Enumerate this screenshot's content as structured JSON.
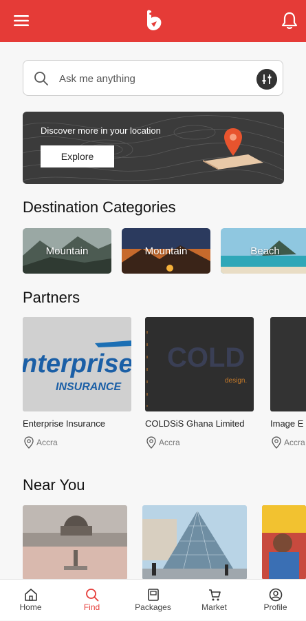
{
  "header": {
    "menu_icon": "hamburger-menu-icon",
    "logo_icon": "app-logo-icon",
    "bell_icon": "notification-bell-icon",
    "brand_color": "#e53b37"
  },
  "search": {
    "placeholder": "Ask me anything",
    "value": "",
    "search_icon": "search-icon",
    "filter_icon": "filter-sliders-icon"
  },
  "banner": {
    "title": "Discover more in your location",
    "button": "Explore",
    "pin_icon": "location-pin-map-icon"
  },
  "categories": {
    "title": "Destination Categories",
    "items": [
      {
        "label": "Mountain"
      },
      {
        "label": "Mountain"
      },
      {
        "label": "Beach"
      }
    ]
  },
  "partners": {
    "title": "Partners",
    "items": [
      {
        "name": "Enterprise Insurance",
        "location": "Accra",
        "logo_line1": "nterprise",
        "logo_line2": "INSURANCE"
      },
      {
        "name": "COLDSiS Ghana Limited",
        "location": "Accra",
        "logo_text": "COLD",
        "tagline": "design."
      },
      {
        "name": "Image E",
        "location": "Accra"
      }
    ]
  },
  "near_you": {
    "title": "Near You"
  },
  "tabs": [
    {
      "label": "Home",
      "icon": "home-icon"
    },
    {
      "label": "Find",
      "icon": "search-icon",
      "active": true
    },
    {
      "label": "Packages",
      "icon": "package-icon"
    },
    {
      "label": "Market",
      "icon": "cart-icon"
    },
    {
      "label": "Profile",
      "icon": "profile-icon"
    }
  ]
}
